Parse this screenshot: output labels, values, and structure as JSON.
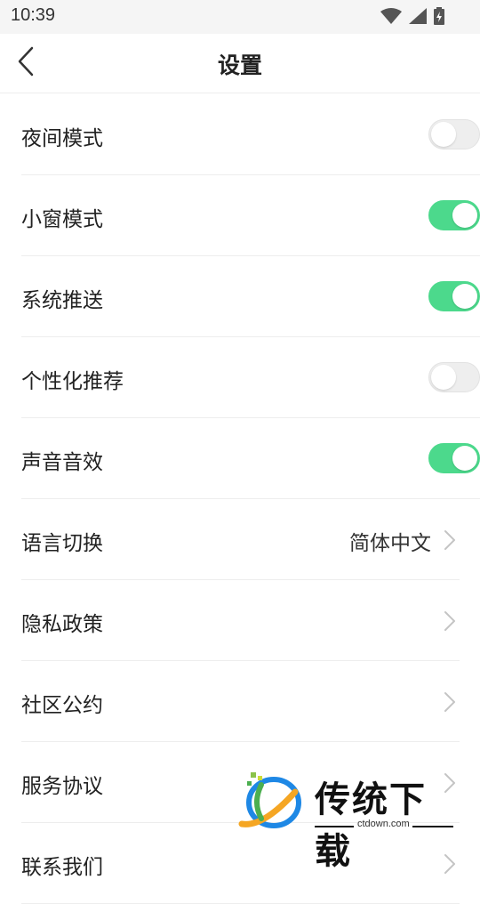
{
  "status_bar": {
    "time": "10:39",
    "icons": [
      "wifi-icon",
      "signal-icon",
      "battery-charging-icon"
    ]
  },
  "nav": {
    "title": "设置",
    "back_icon": "chevron-left-icon"
  },
  "settings": [
    {
      "label": "夜间模式",
      "type": "toggle",
      "on": false
    },
    {
      "label": "小窗模式",
      "type": "toggle",
      "on": true
    },
    {
      "label": "系统推送",
      "type": "toggle",
      "on": true
    },
    {
      "label": "个性化推荐",
      "type": "toggle",
      "on": false
    },
    {
      "label": "声音音效",
      "type": "toggle",
      "on": true
    },
    {
      "label": "语言切换",
      "type": "link",
      "value": "简体中文"
    },
    {
      "label": "隐私政策",
      "type": "link"
    },
    {
      "label": "社区公约",
      "type": "link"
    },
    {
      "label": "服务协议",
      "type": "link"
    },
    {
      "label": "联系我们",
      "type": "link"
    }
  ],
  "watermark": {
    "text": "传统下载",
    "domain": "ctdown.com"
  },
  "colors": {
    "toggle_on": "#4cd98c",
    "toggle_off": "#eeeeee",
    "divider": "#ededed",
    "chevron": "#c4c4c4"
  }
}
